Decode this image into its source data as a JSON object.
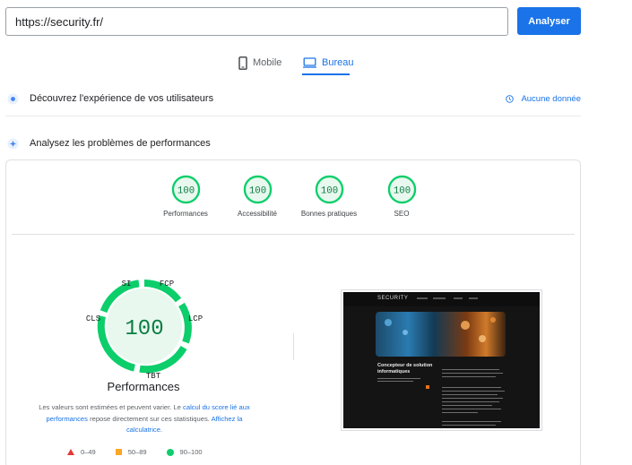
{
  "search": {
    "url_value": "https://security.fr/",
    "analyze_label": "Analyser"
  },
  "tabs": [
    {
      "label": "Mobile",
      "icon": "phone-icon",
      "active": false
    },
    {
      "label": "Bureau",
      "icon": "monitor-icon",
      "active": true
    }
  ],
  "field_data": {
    "title": "Découvrez l'expérience de vos utilisateurs",
    "no_data": "Aucune donnée"
  },
  "lab_data": {
    "title": "Analysez les problèmes de performances"
  },
  "categories": [
    {
      "label": "Performances",
      "score": "100"
    },
    {
      "label": "Accessibilité",
      "score": "100"
    },
    {
      "label": "Bonnes pratiques",
      "score": "100"
    },
    {
      "label": "SEO",
      "score": "100"
    }
  ],
  "performance": {
    "score": "100",
    "title": "Performances",
    "metrics": {
      "si": "SI",
      "fcp": "FCP",
      "lcp": "LCP",
      "tbt": "TBT",
      "cls": "CLS"
    },
    "desc_part1": "Les valeurs sont estimées et peuvent varier. Le ",
    "desc_link1": "calcul du score lié aux performances",
    "desc_part2": " repose directement sur ces statistiques. ",
    "desc_link2": "Affichez la calculatrice",
    "desc_part3": "."
  },
  "legend": [
    {
      "range": "0–49",
      "color": "#e53935",
      "shape": "triangle"
    },
    {
      "range": "50–89",
      "color": "#f9a825",
      "shape": "square"
    },
    {
      "range": "90–100",
      "color": "#0cce6b",
      "shape": "circle"
    }
  ],
  "screenshot": {
    "logo": "SECURITY",
    "heading": "Concepteur de solution informatiques"
  },
  "colors": {
    "accent": "#1a73e8",
    "pass": "#0cce6b",
    "pass_text": "#0a7c42"
  }
}
